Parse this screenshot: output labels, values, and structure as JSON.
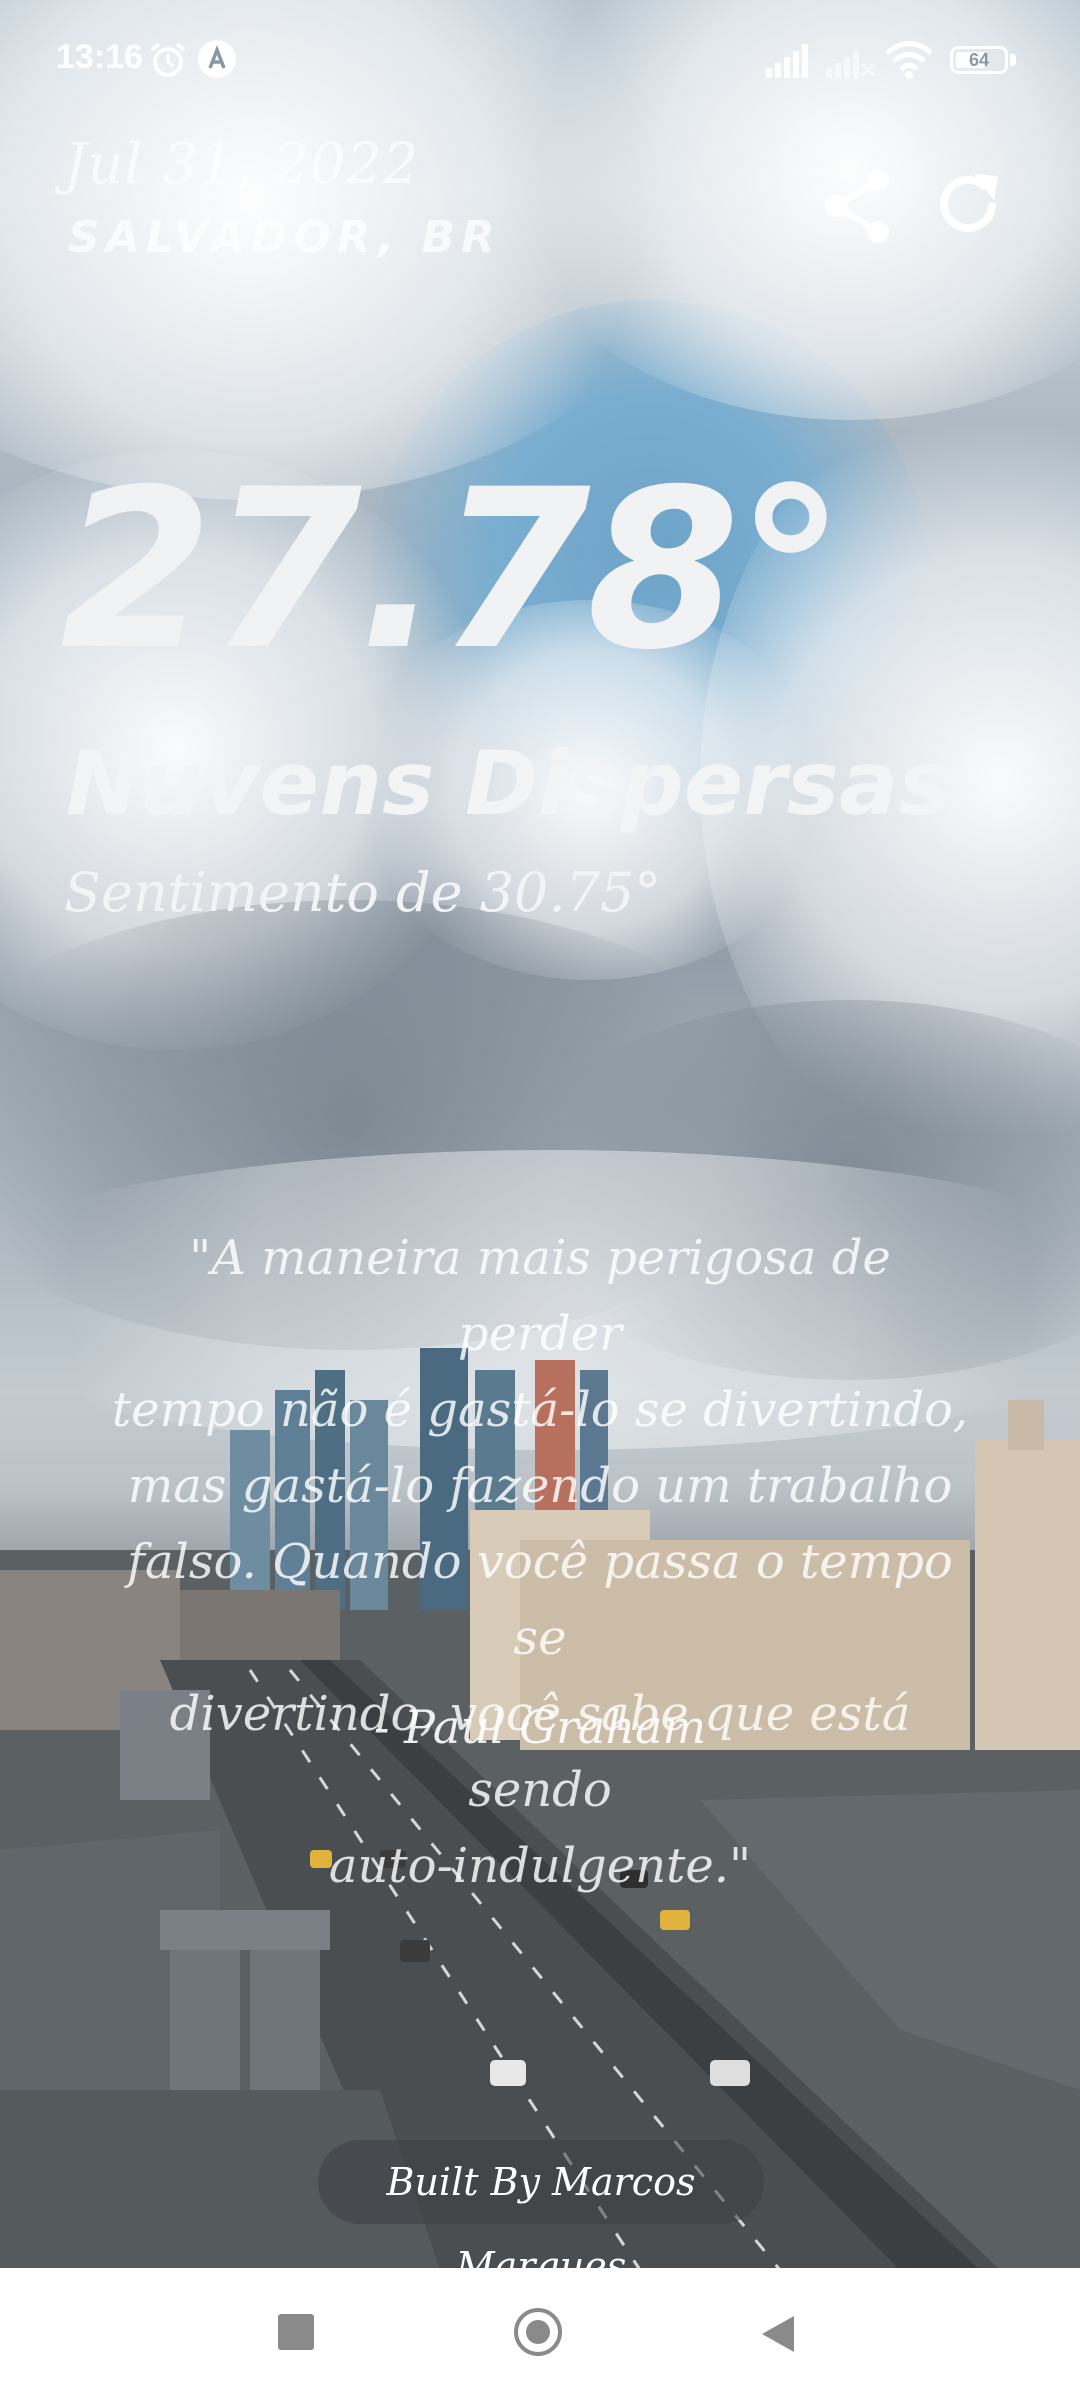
{
  "status_bar": {
    "time": "13:16",
    "battery": "64",
    "battery_level": 0.64,
    "icons": [
      "alarm-icon",
      "account-icon",
      "signal-icon",
      "signal-off-icon",
      "wifi-icon",
      "battery-icon"
    ]
  },
  "header": {
    "date": "Jul 31, 2022",
    "location": "SALVADOR, BR",
    "actions": [
      "share-icon",
      "refresh-icon"
    ]
  },
  "weather": {
    "temperature": "27.78°",
    "description": "Nuvens Dispersas",
    "feels_like": "Sentimento de 30.75°"
  },
  "quote": {
    "lines": [
      "\"A maneira mais perigosa de perder",
      "tempo não é gastá-lo se divertindo,",
      "mas gastá-lo fazendo um trabalho",
      "falso. Quando você passa o tempo se",
      "divertindo, você sabe que está sendo",
      "auto-indulgente.\""
    ],
    "author": "- Paul Graham"
  },
  "footer": {
    "credit": "Built By Marcos Marques"
  },
  "nav_bar": {
    "buttons": [
      "recents-icon",
      "home-icon",
      "back-icon"
    ]
  },
  "colors": {
    "text": "#f1f2f3",
    "sky_blue": "#7aaed0",
    "nav_icon": "#8a8a8a"
  }
}
